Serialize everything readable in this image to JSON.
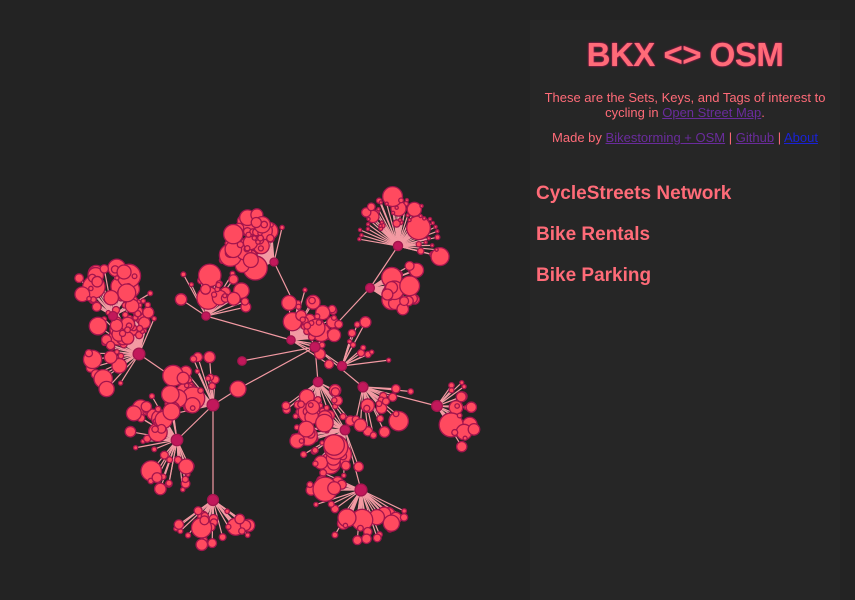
{
  "header": {
    "title": "BKX <> OSM",
    "description_prefix": "These are the Sets, Keys, and Tags of interest to cycling in",
    "description_link": "Open Street Map",
    "description_suffix": ".",
    "made_by_prefix": "Made by",
    "made_by_link": "Bikestorming + OSM",
    "separator": "|",
    "github_link": "Github",
    "about_link": "About"
  },
  "categories": [
    {
      "label": "CycleStreets Network"
    },
    {
      "label": "Bike Rentals"
    },
    {
      "label": "Bike Parking"
    }
  ],
  "colors": {
    "background": "#232323",
    "panel": "#262626",
    "accent": "#ff6b78",
    "node_fill": "#ff4a5f",
    "node_stroke": "#a3154d",
    "hub_fill": "#c2185b",
    "link": "#f39aa3"
  }
}
